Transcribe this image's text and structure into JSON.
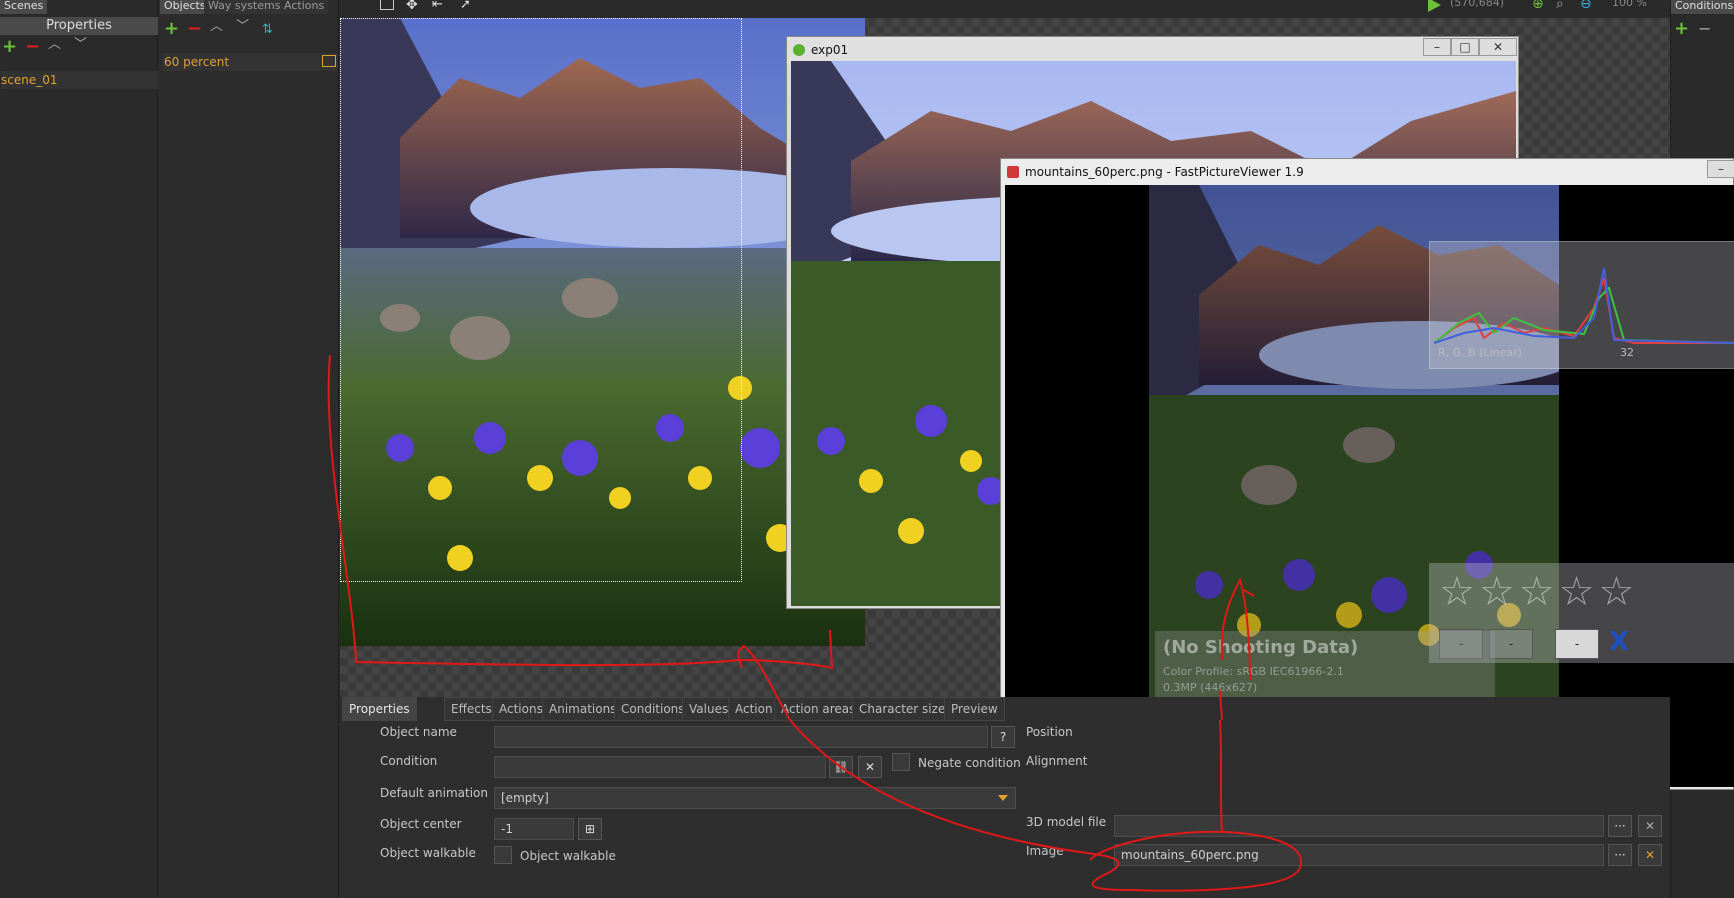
{
  "left_panel": {
    "tab_scenes": "Scenes",
    "header_properties": "Properties",
    "scene_item": "scene_01"
  },
  "objects_panel": {
    "tab_objects": "Objects",
    "tab_way_systems": "Way systems",
    "tab_actions": "Actions",
    "object_item": "60 percent"
  },
  "toolbar": {
    "coords": "(570,684)",
    "zoom": "100 %"
  },
  "right_panel": {
    "tab_conditions": "Conditions"
  },
  "window_exp": {
    "title": "exp01"
  },
  "window_viewer": {
    "title": "mountains_60perc.png - FastPictureViewer 1.9",
    "histogram_label": "R, G, B (Linear)",
    "histogram_value": "32",
    "no_shooting": "(No Shooting Data)",
    "color_profile": "Color Profile: sRGB IEC61966-2.1",
    "megapixels": "0.3MP (446x627)"
  },
  "properties": {
    "tabs": [
      "Properties",
      "Effects",
      "Actions",
      "Animations",
      "Conditions",
      "Values",
      "Action",
      "Action areas",
      "Character size",
      "Preview"
    ],
    "object_name_label": "Object name",
    "condition_label": "Condition",
    "negate_label": "Negate condition",
    "default_anim_label": "Default animation",
    "default_anim_value": "[empty]",
    "object_center_label": "Object center",
    "object_center_value": "-1",
    "object_walkable_label": "Object walkable",
    "object_walkable_check": "Object walkable",
    "position_label": "Position",
    "alignment_label": "Alignment",
    "model_label": "3D model file",
    "image_label": "Image",
    "image_value": "mountains_60perc.png"
  },
  "colors": {
    "accent_green": "#6cc23a",
    "accent_red": "#e02020",
    "accent_orange": "#e0a030",
    "annotation_red": "#e01818"
  }
}
